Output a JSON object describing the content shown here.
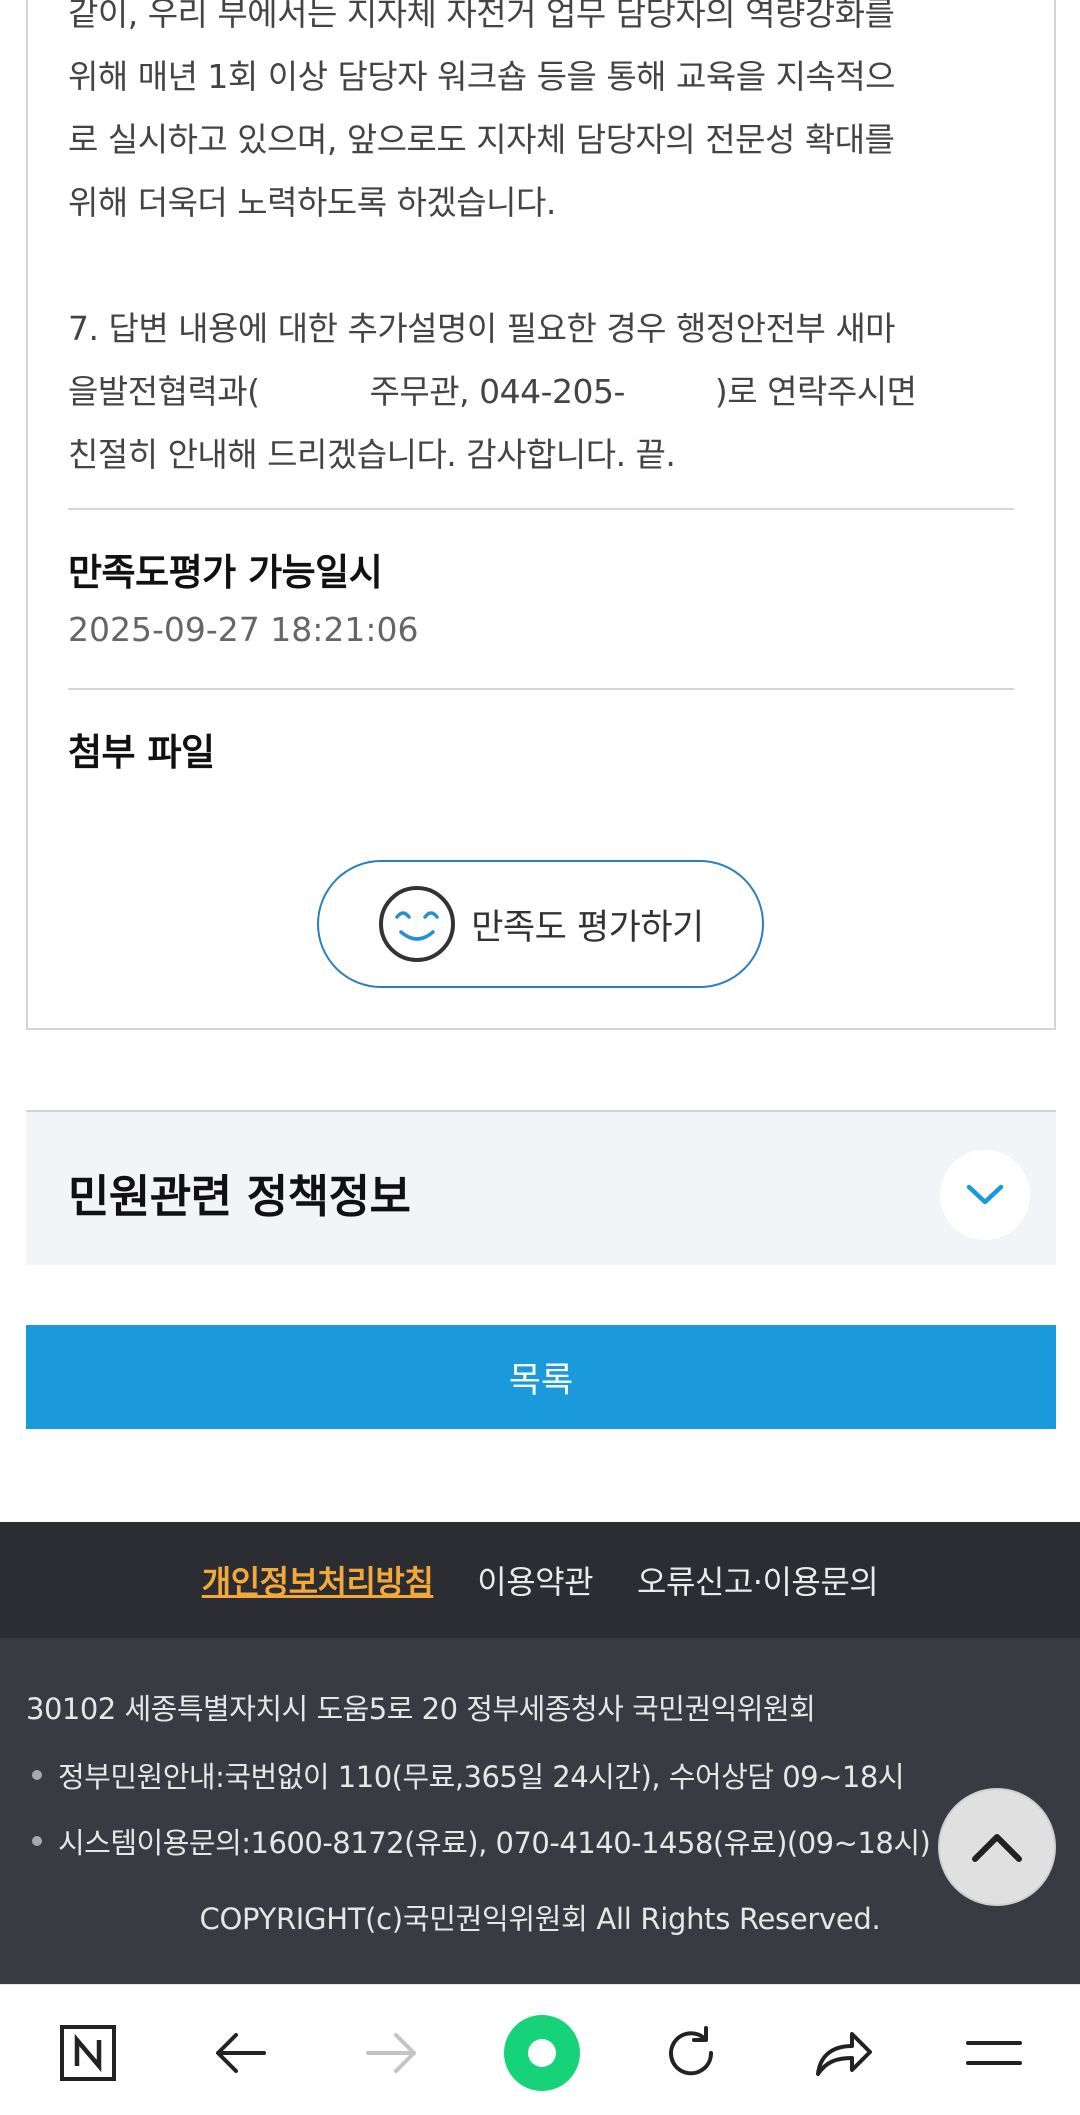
{
  "answer": {
    "paragraph1": "같이, 우리 부에서는 지자체 자전거 업무 담당자의 역량강화를\n위해 매년 1회 이상 담당자 워크숍 등을 통해 교육을 지속적으\n로 실시하고 있으며, 앞으로도 지자체 담당자의 전문성 확대를\n위해 더욱더 노력하도록 하겠습니다.",
    "p2_line1": "7. 답변 내용에 대한 추가설명이 필요한 경우 행정안전부 새마",
    "p2_line2a": "을발전협력과(",
    "p2_line2b": "주무관, 044-205-",
    "p2_line2c": ")로 연락주시면",
    "p2_line3": "친절히 안내해 드리겠습니다. 감사합니다.  끝."
  },
  "satisfaction": {
    "label": "만족도평가 가능일시",
    "value": "2025-09-27 18:21:06"
  },
  "attachment": {
    "label": "첨부 파일"
  },
  "rate_button": {
    "label": "만족도 평가하기",
    "icon": "smile-icon"
  },
  "policy": {
    "title": "민원관련 정책정보",
    "icon": "chevron-down-icon"
  },
  "list_button": {
    "label": "목록"
  },
  "footer": {
    "links": [
      "개인정보처리방침",
      "이용약관",
      "오류신고·이용문의"
    ],
    "address": "30102 세종특별자치시 도움5로 20 정부세종청사 국민권익위원회",
    "info": [
      "정부민원안내:국번없이 110(무료,365일 24시간), 수어상담 09~18시",
      "시스템이용문의:1600-8172(유료), 070-4140-1458(유료)(09~18시)"
    ],
    "copyright": "COPYRIGHT(c)국민권익위원회 All Rights Reserved."
  },
  "browser_bar": {
    "items": [
      "naver-home-icon",
      "back-icon",
      "forward-icon",
      "naver-green-dot-icon",
      "reload-icon",
      "share-icon",
      "menu-icon"
    ]
  },
  "colors": {
    "primary_blue": "#1a99db",
    "footer_dark": "#2b2d33",
    "footer_info": "#393b43",
    "privacy_orange": "#f3a93a"
  }
}
